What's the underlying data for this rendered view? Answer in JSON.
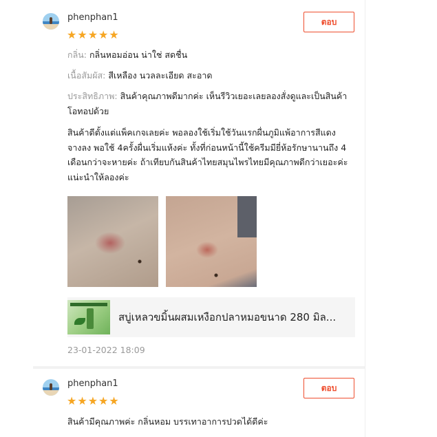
{
  "reviews": [
    {
      "username": "phenphan1",
      "rating": 5,
      "reply_label": "ตอบ",
      "attributes": [
        {
          "label": "กลิ่น:",
          "value": "กลิ่นหอมอ่อน น่าใช่ สดชื่น"
        },
        {
          "label": "เนื้อสัมผัส:",
          "value": "สีเหลือง นวลละเอียด สะอาด"
        },
        {
          "label": "ประสิทธิภาพ:",
          "value": "สินค้าคุณภาพดีมากค่ะ เห็นรีวิวเยอะเลยลองสั่งดูและเป็นสินค้าโอทอปด้วย"
        }
      ],
      "body": "สินค้าดีตั้งแต่แพ็คเกจเลยค่ะ พอลองใช้เริ่มใช้วันแรกผื่นภูมิแพ้อาการสีแดงจางลง พอใช้ 4ครั้งผื่นเริ่มแห้งค่ะ ทั้งที่ก่อนหน้านี้ใช้ครีมมียี่ห้อรักษานานถึง 4 เดือนกว่าจะหายค่ะ ถ้าเทียบกันสินค้าไทยสมุนไพรไทยมีคุณภาพดีกว่าเยอะค่ะ แน่ะนำให้ลองค่ะ",
      "product_name": "สบู่เหลวขมิ้นผสมเหงือกปลาหมอขนาด 280 มิล...",
      "timestamp": "23-01-2022 18:09"
    },
    {
      "username": "phenphan1",
      "rating": 5,
      "reply_label": "ตอบ",
      "body": "สินค้ามีคุณภาพค่ะ กลิ่นหอม บรรเทาอาการปวดได้ดีค่ะ"
    }
  ],
  "colors": {
    "accent": "#ee4d2d",
    "star": "#f6a623",
    "muted": "#999999"
  }
}
